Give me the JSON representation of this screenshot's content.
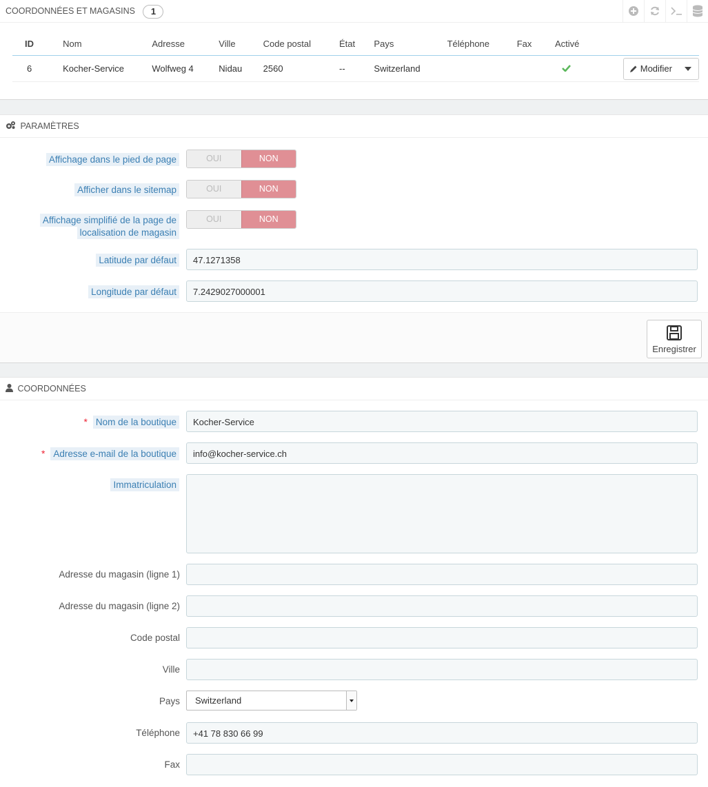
{
  "stores_panel": {
    "title": "Coordonnées et magasins",
    "count": "1",
    "columns": [
      "ID",
      "Nom",
      "Adresse",
      "Ville",
      "Code postal",
      "État",
      "Pays",
      "Téléphone",
      "Fax",
      "Activé"
    ],
    "rows": [
      {
        "id": "6",
        "nom": "Kocher-Service",
        "adresse": "Wolfweg 4",
        "ville": "Nidau",
        "code_postal": "2560",
        "etat": "--",
        "pays": "Switzerland",
        "telephone": "",
        "fax": "",
        "active": "check-icon"
      }
    ],
    "edit_label": "Modifier"
  },
  "params_panel": {
    "title": "Paramètres",
    "footer_label": "Affichage dans le pied de page",
    "sitemap_label": "Afficher dans le sitemap",
    "simplified_label_1": "Affichage simplifié de la page de",
    "simplified_label_2": "localisation de magasin",
    "yes": "OUI",
    "no": "NON",
    "latitude_label": "Latitude par défaut",
    "latitude_value": "47.1271358",
    "longitude_label": "Longitude par défaut",
    "longitude_value": "7.2429027000001",
    "save_label": "Enregistrer"
  },
  "contact_panel": {
    "title": "Coordonnées",
    "shop_name_label": "Nom de la boutique",
    "shop_name_value": "Kocher-Service",
    "email_label": "Adresse e-mail de la boutique",
    "email_value": "info@kocher-service.ch",
    "registration_label": "Immatriculation",
    "registration_value": "",
    "address1_label": "Adresse du magasin (ligne 1)",
    "address2_label": "Adresse du magasin (ligne 2)",
    "postcode_label": "Code postal",
    "city_label": "Ville",
    "country_label": "Pays",
    "country_value": "Switzerland",
    "phone_label": "Téléphone",
    "phone_value": "+41 78 830 66 99",
    "fax_label": "Fax",
    "required_mark": "*"
  },
  "colors": {
    "switch_off": "#e08f95",
    "hint_bg": "#e8f0f7",
    "hint_text": "#3b7fb3",
    "check": "#5cb85c",
    "required": "#e23"
  }
}
